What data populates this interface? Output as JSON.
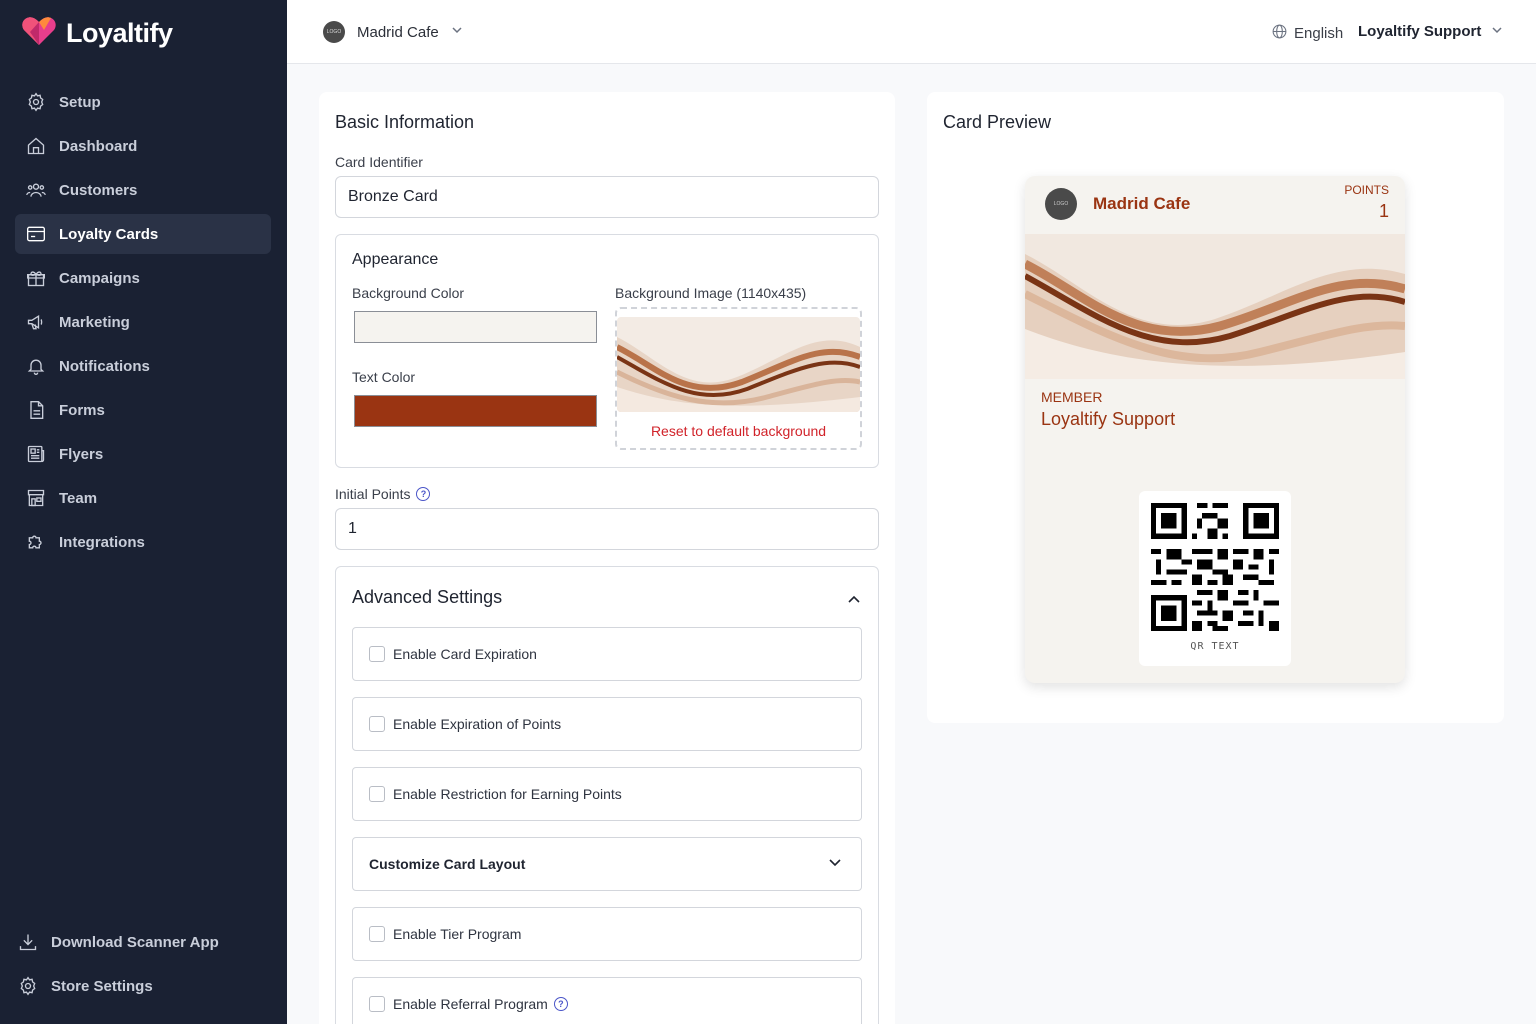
{
  "app": {
    "brand": "Loyaltify"
  },
  "sidebar": {
    "items": [
      {
        "label": "Setup",
        "icon": "gear-icon"
      },
      {
        "label": "Dashboard",
        "icon": "home-icon"
      },
      {
        "label": "Customers",
        "icon": "users-icon"
      },
      {
        "label": "Loyalty Cards",
        "icon": "card-icon",
        "active": true
      },
      {
        "label": "Campaigns",
        "icon": "gift-icon"
      },
      {
        "label": "Marketing",
        "icon": "megaphone-icon"
      },
      {
        "label": "Notifications",
        "icon": "bell-icon"
      },
      {
        "label": "Forms",
        "icon": "document-icon"
      },
      {
        "label": "Flyers",
        "icon": "newspaper-icon"
      },
      {
        "label": "Team",
        "icon": "store-icon"
      },
      {
        "label": "Integrations",
        "icon": "puzzle-icon"
      }
    ],
    "bottom": [
      {
        "label": "Download Scanner App",
        "icon": "download-icon"
      },
      {
        "label": "Store Settings",
        "icon": "gear-icon"
      }
    ]
  },
  "header": {
    "store_logo_text": "LOGO",
    "store_name": "Madrid Cafe",
    "language": "English",
    "user": "Loyaltify Support"
  },
  "form": {
    "section_title": "Basic Information",
    "card_identifier_label": "Card Identifier",
    "card_identifier_value": "Bronze Card",
    "appearance": {
      "title": "Appearance",
      "bg_color_label": "Background Color",
      "bg_color": "#f5f3ef",
      "text_color_label": "Text Color",
      "text_color": "#9a3412",
      "bg_image_label": "Background Image (1140x435)",
      "reset_label": "Reset to default background"
    },
    "initial_points_label": "Initial Points",
    "initial_points_value": "1",
    "advanced": {
      "title": "Advanced Settings",
      "expiration": "Enable Card Expiration",
      "points_expiration": "Enable Expiration of Points",
      "restriction": "Enable Restriction for Earning Points",
      "layout": "Customize Card Layout",
      "tier": "Enable Tier Program",
      "referral": "Enable Referral Program"
    }
  },
  "preview": {
    "title": "Card Preview",
    "logo_text": "LOGO",
    "store_name": "Madrid Cafe",
    "points_label": "POINTS",
    "points_value": "1",
    "member_label": "MEMBER",
    "member_name": "Loyaltify Support",
    "qr_text": "QR TEXT"
  }
}
